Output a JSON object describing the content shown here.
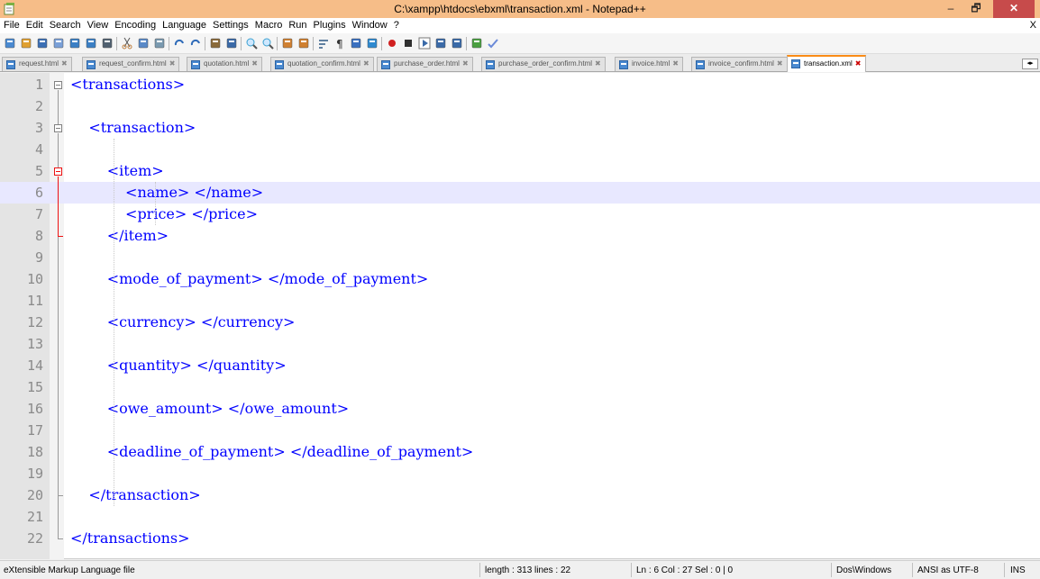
{
  "window": {
    "title": "C:\\xampp\\htdocs\\ebxml\\transaction.xml - Notepad++",
    "minimize_glyph": "‒",
    "maximize_glyph": "🗗",
    "close_glyph": "✕"
  },
  "menu": {
    "items": [
      "File",
      "Edit",
      "Search",
      "View",
      "Encoding",
      "Language",
      "Settings",
      "Macro",
      "Run",
      "Plugins",
      "Window",
      "?"
    ],
    "close_label": "X"
  },
  "toolbar": {
    "icons": [
      "new-file-icon",
      "open-file-icon",
      "save-icon",
      "save-all-icon",
      "close-icon",
      "close-all-icon",
      "print-icon",
      "cut-icon",
      "copy-icon",
      "paste-icon",
      "undo-icon",
      "redo-icon",
      "find-icon",
      "replace-icon",
      "zoom-in-icon",
      "zoom-out-icon",
      "sync-vertical-icon",
      "sync-horizontal-icon",
      "word-wrap-icon",
      "show-all-chars-icon",
      "indent-guide-icon",
      "doc-map-icon",
      "macro-record-icon",
      "macro-stop-icon",
      "macro-play-icon",
      "macro-run-multiple-icon",
      "macro-save-icon",
      "launch-browser-icon",
      "spellcheck-icon"
    ]
  },
  "tabs": [
    {
      "label": "request.html",
      "active": false
    },
    {
      "label": "request_confirm.html",
      "active": false
    },
    {
      "label": "quotation.html",
      "active": false
    },
    {
      "label": "quotation_confirm.html",
      "active": false
    },
    {
      "label": "purchase_order.html",
      "active": false
    },
    {
      "label": "purchase_order_confirm.html",
      "active": false
    },
    {
      "label": "invoice.html",
      "active": false
    },
    {
      "label": "invoice_confirm.html",
      "active": false
    },
    {
      "label": "transaction.xml",
      "active": true
    }
  ],
  "tab_close_glyph": "✖",
  "tab_scroll_glyph": "◂▸",
  "editor": {
    "current_line": 6,
    "lines": [
      {
        "num": "1",
        "text": "<transactions>"
      },
      {
        "num": "2",
        "text": ""
      },
      {
        "num": "3",
        "text": "    <transaction>"
      },
      {
        "num": "4",
        "text": ""
      },
      {
        "num": "5",
        "text": "        <item>"
      },
      {
        "num": "6",
        "text": "            <name> </name>"
      },
      {
        "num": "7",
        "text": "            <price> </price>"
      },
      {
        "num": "8",
        "text": "        </item>"
      },
      {
        "num": "9",
        "text": ""
      },
      {
        "num": "10",
        "text": "        <mode_of_payment> </mode_of_payment>"
      },
      {
        "num": "11",
        "text": ""
      },
      {
        "num": "12",
        "text": "        <currency> </currency>"
      },
      {
        "num": "13",
        "text": ""
      },
      {
        "num": "14",
        "text": "        <quantity> </quantity>"
      },
      {
        "num": "15",
        "text": ""
      },
      {
        "num": "16",
        "text": "        <owe_amount> </owe_amount>"
      },
      {
        "num": "17",
        "text": ""
      },
      {
        "num": "18",
        "text": "        <deadline_of_payment> </deadline_of_payment>"
      },
      {
        "num": "19",
        "text": ""
      },
      {
        "num": "20",
        "text": "    </transaction>"
      },
      {
        "num": "21",
        "text": ""
      },
      {
        "num": "22",
        "text": "</transactions>"
      }
    ]
  },
  "status": {
    "file_type": "eXtensible Markup Language file",
    "length_lines": "length : 313    lines : 22",
    "position": "Ln : 6    Col : 27    Sel : 0 | 0",
    "eol": "Dos\\Windows",
    "encoding": "ANSI as UTF-8",
    "mode": "INS"
  },
  "colors": {
    "title_bar": "#f6bd88",
    "code_text": "#0000ff",
    "current_line": "#e8e8ff",
    "active_tab_accent": "#fa8c17",
    "fold_highlight": "#ee1111"
  }
}
